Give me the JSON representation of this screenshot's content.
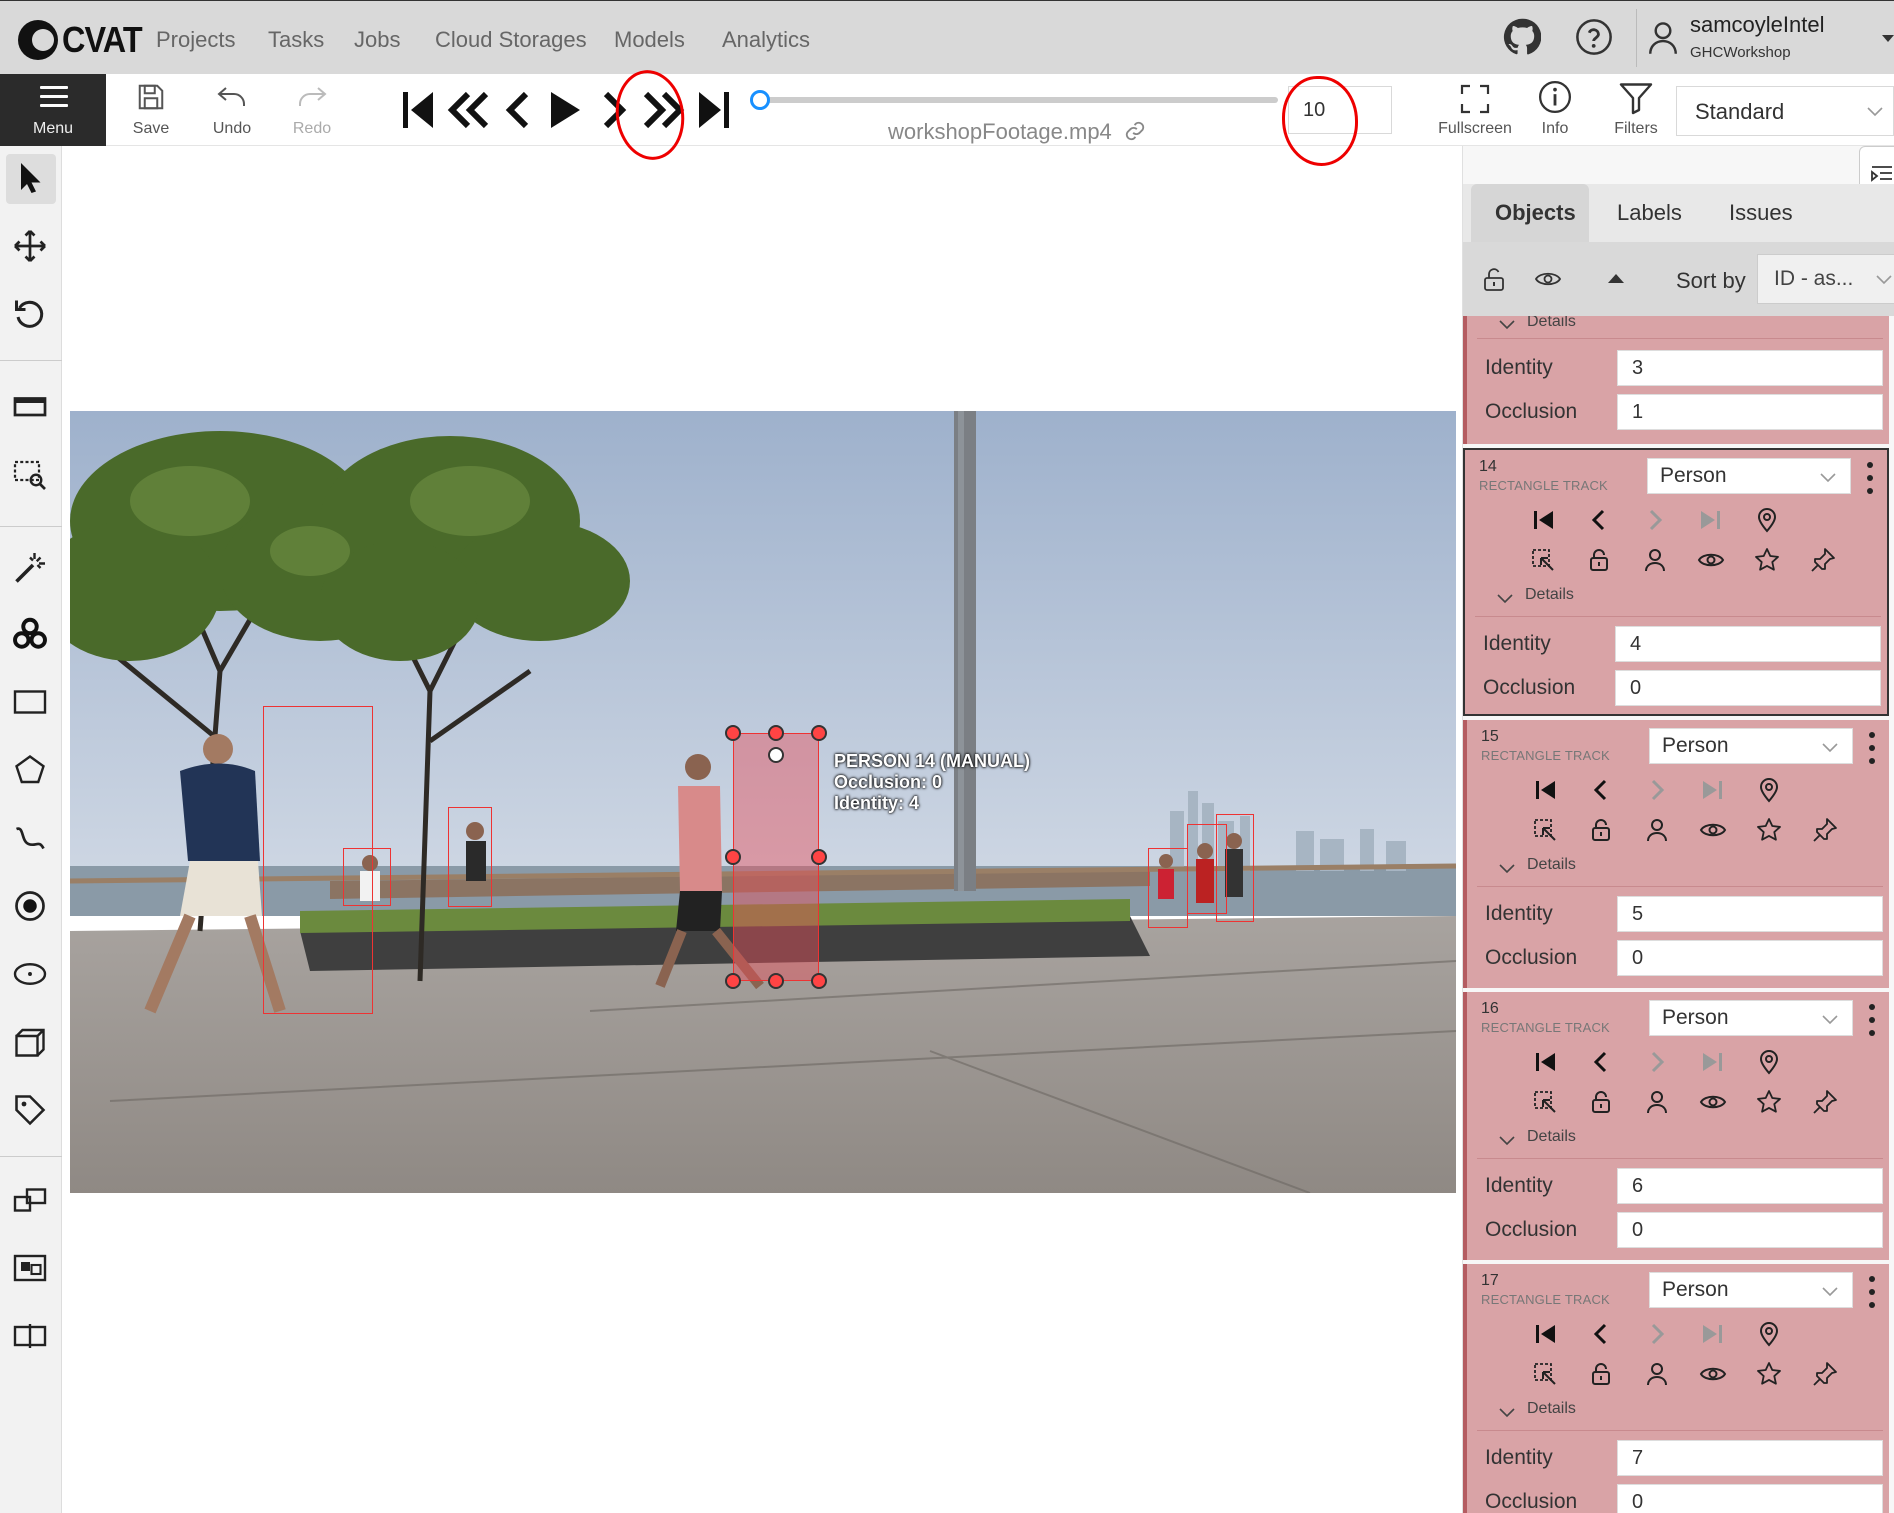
{
  "header": {
    "logo_text": "CVAT",
    "nav": [
      "Projects",
      "Tasks",
      "Jobs",
      "Cloud Storages",
      "Models",
      "Analytics"
    ],
    "user_name": "samcoyleIntel",
    "user_org": "GHCWorkshop"
  },
  "toolbar": {
    "menu_label": "Menu",
    "save_label": "Save",
    "undo_label": "Undo",
    "redo_label": "Redo",
    "filename": "workshopFootage.mp4",
    "frame_number": "10",
    "frame_progress": 0.0,
    "fullscreen_label": "Fullscreen",
    "info_label": "Info",
    "filters_label": "Filters",
    "workspace": "Standard"
  },
  "canvas": {
    "selected_label_line1": "PERSON 14 (MANUAL)",
    "selected_label_line2": "Occlusion: 0",
    "selected_label_line3": "Identity: 4"
  },
  "sidebar": {
    "tabs": [
      "Objects",
      "Labels",
      "Issues"
    ],
    "active_tab": "Objects",
    "sort_label": "Sort by",
    "sort_value": "ID - as...",
    "details_label": "Details",
    "partial_card": {
      "attributes": [
        {
          "name": "Identity",
          "value": "3"
        },
        {
          "name": "Occlusion",
          "value": "1"
        }
      ]
    },
    "cards": [
      {
        "id": "14",
        "type": "RECTANGLE TRACK",
        "label": "Person",
        "identity_name": "Identity",
        "identity": "4",
        "occlusion_name": "Occlusion",
        "occlusion": "0"
      },
      {
        "id": "15",
        "type": "RECTANGLE TRACK",
        "label": "Person",
        "identity_name": "Identity",
        "identity": "5",
        "occlusion_name": "Occlusion",
        "occlusion": "0"
      },
      {
        "id": "16",
        "type": "RECTANGLE TRACK",
        "label": "Person",
        "identity_name": "Identity",
        "identity": "6",
        "occlusion_name": "Occlusion",
        "occlusion": "0"
      },
      {
        "id": "17",
        "type": "RECTANGLE TRACK",
        "label": "Person",
        "identity_name": "Identity",
        "identity": "7",
        "occlusion_name": "Occlusion",
        "occlusion": "0"
      }
    ]
  },
  "colors": {
    "card_bg": "#d9a3a6",
    "bbox": "#ee3333",
    "accent": "#1890ff",
    "annotation_circle": "#ee0000"
  }
}
